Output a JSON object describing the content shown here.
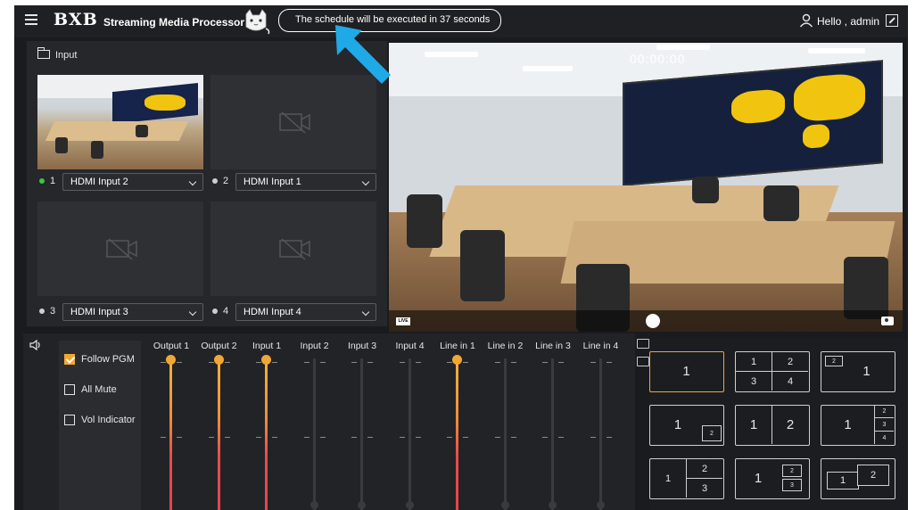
{
  "header": {
    "logo": "BXB",
    "app_title": "Streaming Media Processor",
    "schedule_text": "The schedule will be executed in 37 seconds",
    "greeting": "Hello , admin"
  },
  "input_panel": {
    "title": "Input",
    "tiles": [
      {
        "num": "1",
        "source": "HDMI Input 2",
        "active": true
      },
      {
        "num": "2",
        "source": "HDMI Input 1",
        "active": false
      },
      {
        "num": "3",
        "source": "HDMI Input 3",
        "active": false
      },
      {
        "num": "4",
        "source": "HDMI Input 4",
        "active": false
      }
    ]
  },
  "preview": {
    "timer": "00:00:00",
    "live_badge": "LIVE"
  },
  "audio": {
    "options": [
      {
        "label": "Follow PGM",
        "checked": true
      },
      {
        "label": "All Mute",
        "checked": false
      },
      {
        "label": "Vol Indicator",
        "checked": false
      }
    ],
    "channels": [
      {
        "label": "Output 1",
        "active": true
      },
      {
        "label": "Output 2",
        "active": true
      },
      {
        "label": "Input 1",
        "active": true
      },
      {
        "label": "Input 2",
        "active": false
      },
      {
        "label": "Input 3",
        "active": false
      },
      {
        "label": "Input 4",
        "active": false
      },
      {
        "label": "Line in 1",
        "active": true
      },
      {
        "label": "Line in 2",
        "active": false
      },
      {
        "label": "Line in 3",
        "active": false
      },
      {
        "label": "Line in 4",
        "active": false
      }
    ]
  },
  "layouts": {
    "selected": "single",
    "cells": {
      "l1": [
        "1"
      ],
      "l2": [
        "1",
        "2",
        "3",
        "4"
      ],
      "l3": [
        "2",
        "1"
      ],
      "l4": [
        "1",
        "2"
      ],
      "l5": [
        "1",
        "2"
      ],
      "l6": [
        "1",
        "2",
        "3",
        "4"
      ],
      "l7": [
        "1",
        "2",
        "3"
      ],
      "l8": [
        "1",
        "2",
        "3"
      ],
      "l9": [
        "1",
        "2"
      ]
    }
  },
  "colors": {
    "accent": "#f0a833",
    "active_dot": "#3ec24b",
    "meter_red": "#e8434a",
    "cursor_blue": "#1fa9e6"
  }
}
